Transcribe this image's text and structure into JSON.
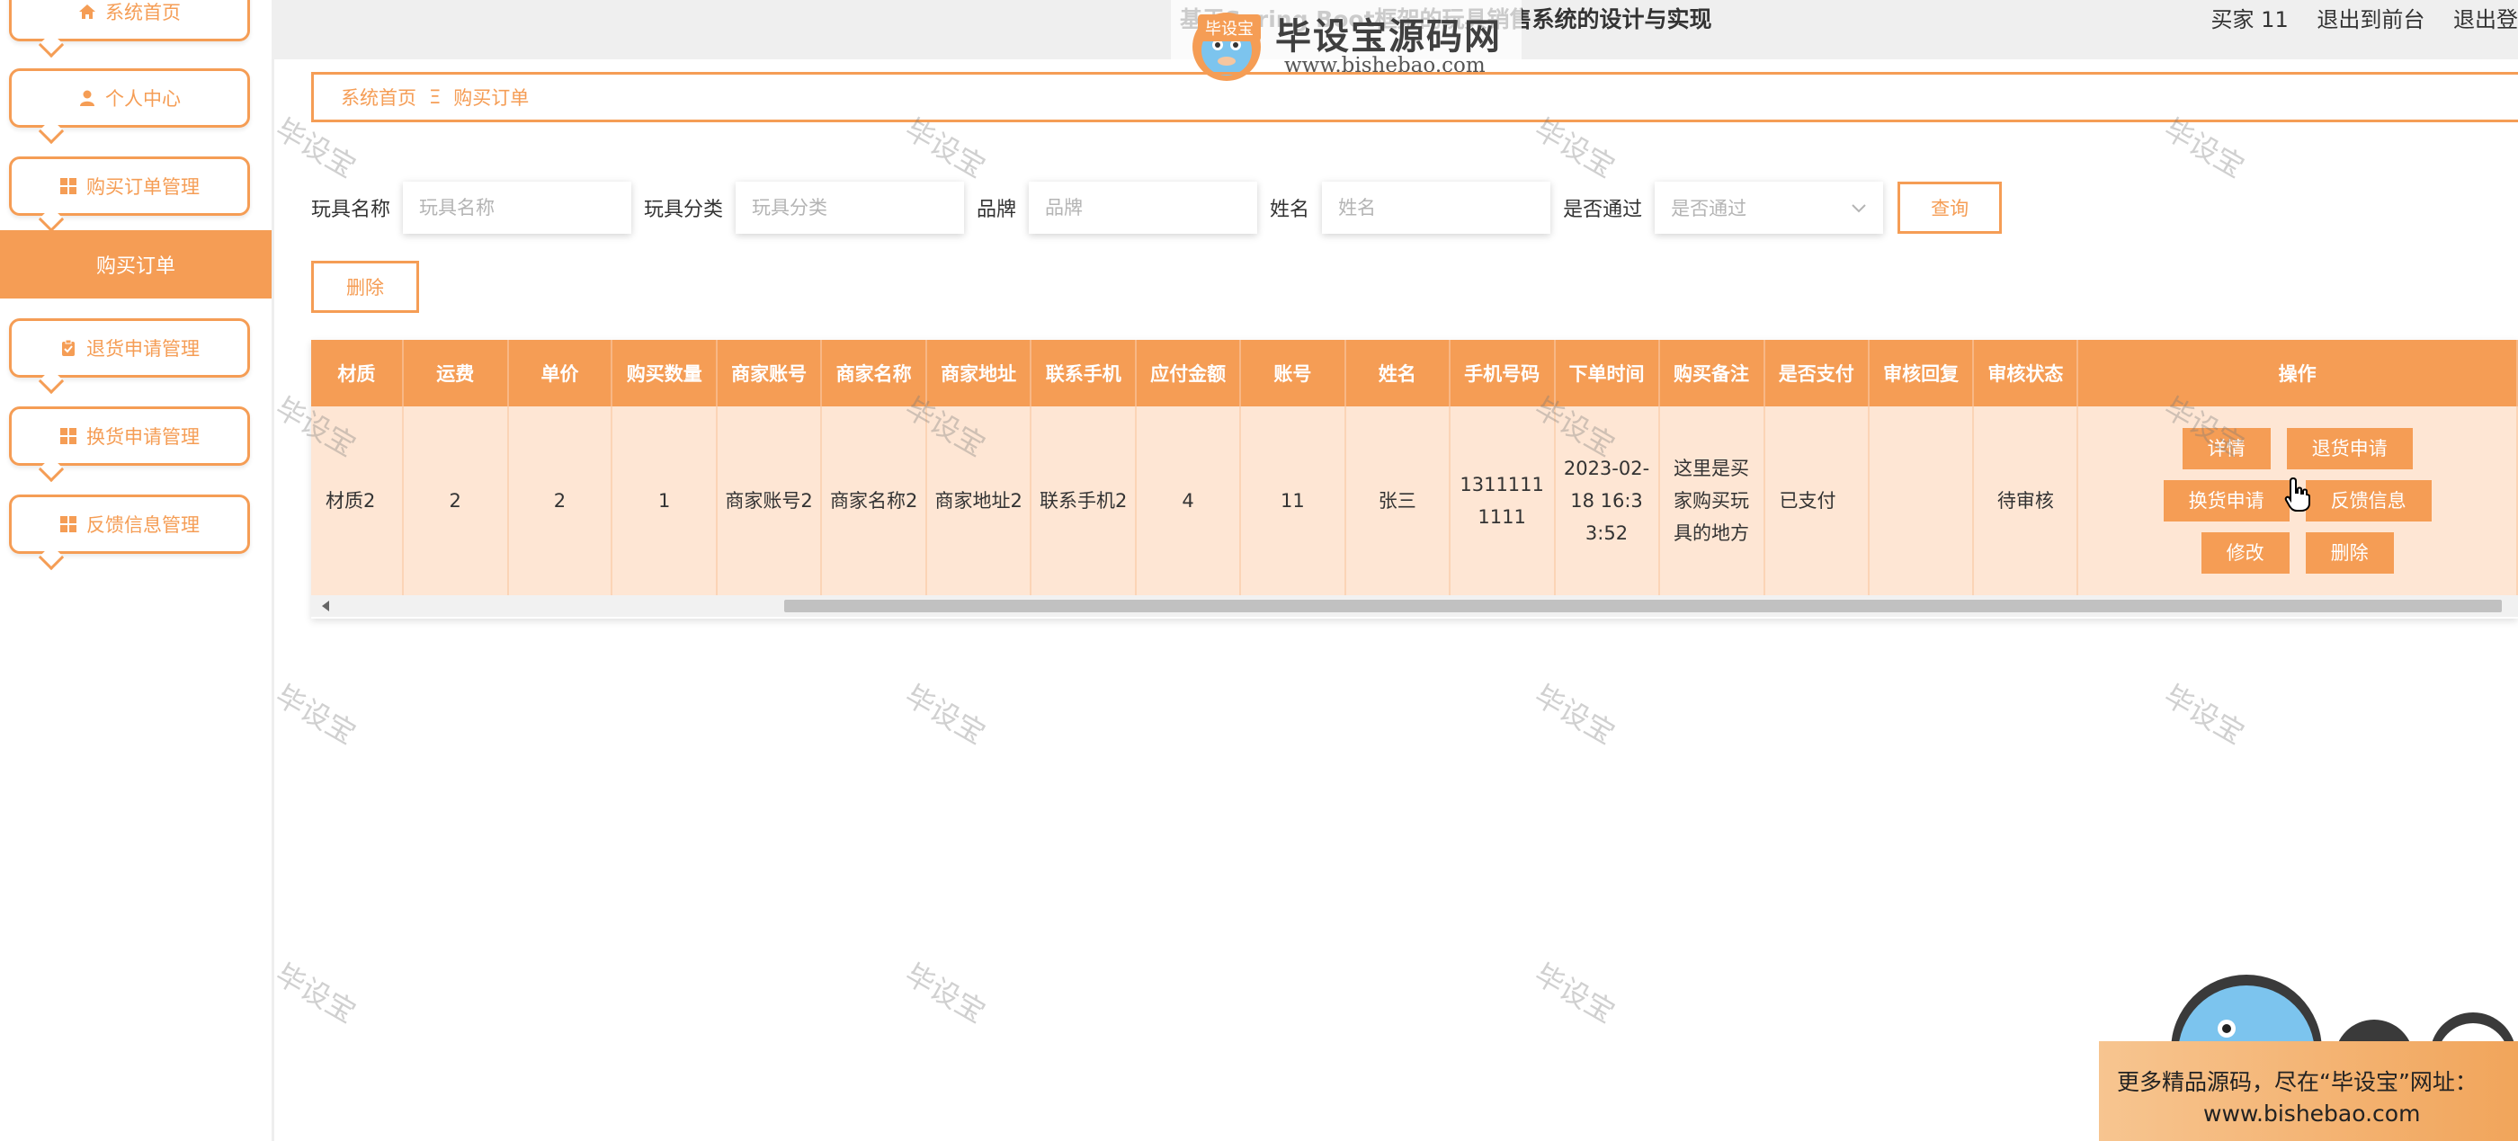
{
  "header": {
    "title": "基于Spring Boot框架的玩具销售系统的设计与实现",
    "user_info": "买家 11",
    "back_front": "退出到前台",
    "logout": "退出登"
  },
  "logo": {
    "main_text": "毕设宝源码网",
    "url_text": "www.bishebao.com",
    "tag": "毕设宝"
  },
  "sidebar": {
    "items": [
      {
        "label": "系统首页",
        "icon": "home-icon"
      },
      {
        "label": "个人中心",
        "icon": "user-icon"
      },
      {
        "label": "购买订单管理",
        "icon": "grid-icon"
      },
      {
        "label": "购买订单",
        "active": true
      },
      {
        "label": "退货申请管理",
        "icon": "clipboard-icon"
      },
      {
        "label": "换货申请管理",
        "icon": "grid-icon"
      },
      {
        "label": "反馈信息管理",
        "icon": "grid-icon"
      }
    ]
  },
  "breadcrumb": {
    "home": "系统首页",
    "separator": "Ξ",
    "current": "购买订单"
  },
  "search": {
    "toy_name_label": "玩具名称",
    "toy_name_placeholder": "玩具名称",
    "category_label": "玩具分类",
    "category_placeholder": "玩具分类",
    "brand_label": "品牌",
    "brand_placeholder": "品牌",
    "name_label": "姓名",
    "name_placeholder": "姓名",
    "approved_label": "是否通过",
    "approved_placeholder": "是否通过",
    "query_button": "查询"
  },
  "toolbar": {
    "delete_button": "删除"
  },
  "table": {
    "columns": [
      "材质",
      "运费",
      "单价",
      "购买数量",
      "商家账号",
      "商家名称",
      "商家地址",
      "联系手机",
      "应付金额",
      "账号",
      "姓名",
      "手机号码",
      "下单时间",
      "购买备注",
      "是否支付",
      "审核回复",
      "审核状态",
      "操作"
    ],
    "rows": [
      {
        "material": "材质2",
        "shipping": "2",
        "unit_price": "2",
        "quantity": "1",
        "merchant_account": "商家账号2",
        "merchant_name": "商家名称2",
        "merchant_address": "商家地址2",
        "contact_phone": "联系手机2",
        "amount_due": "4",
        "account": "11",
        "name": "张三",
        "phone": "13111111111",
        "order_time": "2023-02-18 16:33:52",
        "remark": "这里是买家购买玩具的地方",
        "paid": "已支付",
        "review_reply": "",
        "review_status": "待审核"
      }
    ],
    "actions": {
      "detail": "详情",
      "return_request": "退货申请",
      "exchange_request": "换货申请",
      "feedback": "反馈信息",
      "edit": "修改",
      "delete": "删除"
    }
  },
  "watermark": "毕设宝",
  "banner": {
    "line1": "更多精品源码，尽在“毕设宝”网址：",
    "line2": "www.bishebao.com"
  },
  "colors": {
    "accent": "#f59d55",
    "row_bg": "#fee6d4",
    "header_bg": "#efefef"
  }
}
